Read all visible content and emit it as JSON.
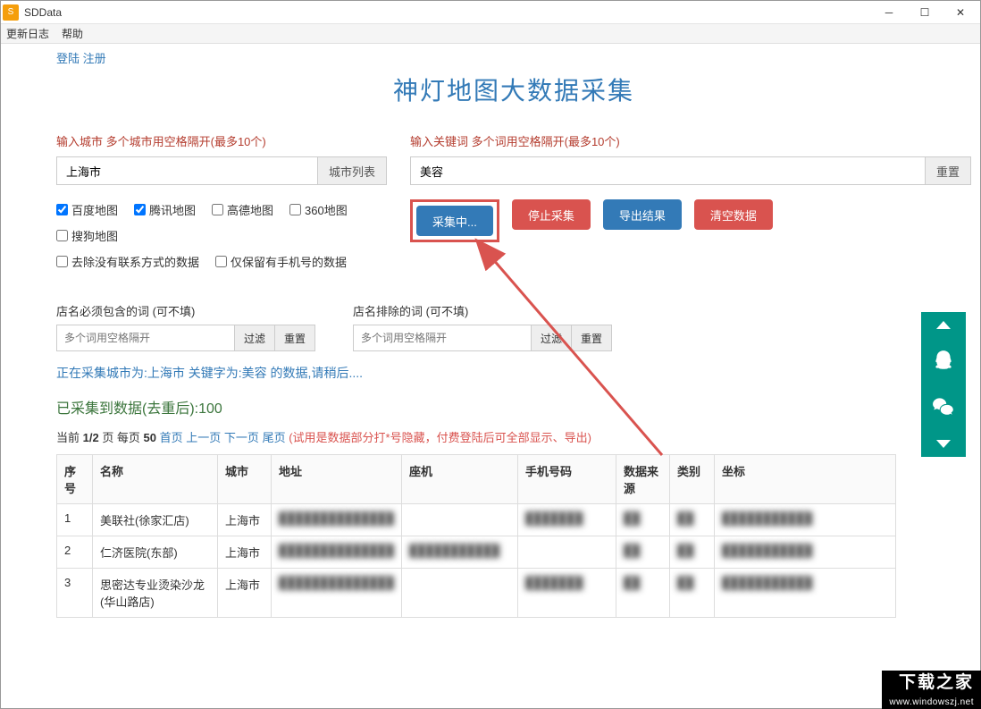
{
  "window": {
    "title": "SDData"
  },
  "menubar": {
    "items": [
      "更新日志",
      "帮助"
    ]
  },
  "auth": {
    "login": "登陆",
    "register": "注册"
  },
  "page_title": "神灯地图大数据采集",
  "city": {
    "label": "输入城市 多个城市用空格隔开(最多10个)",
    "value": "上海市",
    "addon": "城市列表"
  },
  "keyword": {
    "label": "输入关键词 多个词用空格隔开(最多10个)",
    "value": "美容",
    "addon": "重置"
  },
  "maps": {
    "baidu": "百度地图",
    "tencent": "腾讯地图",
    "gaode": "高德地图",
    "s360": "360地图",
    "sogou": "搜狗地图",
    "baidu_checked": true,
    "tencent_checked": true,
    "gaode_checked": false,
    "s360_checked": false,
    "sogou_checked": false
  },
  "options": {
    "remove_no_contact": "去除没有联系方式的数据",
    "keep_mobile_only": "仅保留有手机号的数据"
  },
  "actions": {
    "collect": "采集中...",
    "stop": "停止采集",
    "export": "导出结果",
    "clear": "清空数据"
  },
  "filter_include": {
    "label": "店名必须包含的词 (可不填)",
    "placeholder": "多个词用空格隔开",
    "btn_filter": "过滤",
    "btn_reset": "重置"
  },
  "filter_exclude": {
    "label": "店名排除的词 (可不填)",
    "placeholder": "多个词用空格隔开",
    "btn_filter": "过滤",
    "btn_reset": "重置"
  },
  "status_line": "正在采集城市为:上海市 关键字为:美容 的数据,请稍后....",
  "count_line": "已采集到数据(去重后):100",
  "pagination": {
    "prefix": "当前 ",
    "page": "1/2",
    "mid": " 页 每页 ",
    "per": "50",
    "home": "首页",
    "prev": "上一页",
    "next": "下一页",
    "last": "尾页",
    "note": "(试用是数据部分打*号隐藏，付费登陆后可全部显示、导出)"
  },
  "table": {
    "headers": [
      "序号",
      "名称",
      "城市",
      "地址",
      "座机",
      "手机号码",
      "数据来源",
      "类别",
      "坐标"
    ],
    "rows": [
      {
        "idx": "1",
        "name": "美联社(徐家汇店)",
        "city": "上海市",
        "addr": "██████████████",
        "phone": "",
        "mobile": "███████",
        "src": "██",
        "cat": "██",
        "coord": "███████████"
      },
      {
        "idx": "2",
        "name": "仁济医院(东部)",
        "city": "上海市",
        "addr": "██████████████",
        "phone": "███████████",
        "mobile": "",
        "src": "██",
        "cat": "██",
        "coord": "███████████"
      },
      {
        "idx": "3",
        "name": "思密达专业烫染沙龙(华山路店)",
        "city": "上海市",
        "addr": "██████████████",
        "phone": "",
        "mobile": "███████",
        "src": "██",
        "cat": "██",
        "coord": "███████████"
      }
    ]
  },
  "watermark": {
    "big": "下载之家",
    "small": "www.windowszj.net"
  }
}
